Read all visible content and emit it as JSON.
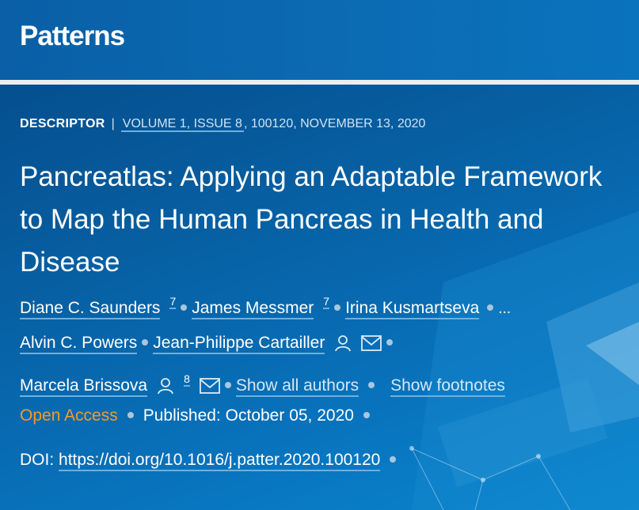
{
  "header": {
    "logo": "Patterns"
  },
  "meta": {
    "article_type": "DESCRIPTOR",
    "separator": "|",
    "issue_link": "VOLUME 1, ISSUE 8",
    "issue_rest": ", 100120, NOVEMBER 13, 2020"
  },
  "article": {
    "title": "Pancreatlas: Applying an Adaptable Framework to Map the Human Pancreas in Health and Disease",
    "authors": [
      {
        "name": "Diane C. Saunders",
        "sup": "7"
      },
      {
        "name": "James Messmer",
        "sup": "7"
      },
      {
        "name": "Irina Kusmartseva"
      },
      {
        "name": "Alvin C. Powers"
      },
      {
        "name": "Jean-Philippe Cartailler"
      },
      {
        "name": "Marcela Brissova",
        "sup": "8"
      }
    ],
    "ellipsis": "...",
    "show_all_authors": "Show all authors",
    "show_footnotes": "Show footnotes",
    "open_access": "Open Access",
    "published_label": "Published:",
    "published_date": "October 05, 2020",
    "doi_label": "DOI:",
    "doi_link": "https://doi.org/10.1016/j.patter.2020.100120"
  },
  "colors": {
    "header_bg": "#0a63a8",
    "hero_bg": "#0760a3",
    "open_access": "#f39a2a",
    "link_underline": "#6fb0dc"
  },
  "icons": [
    "person-icon",
    "mail-icon"
  ]
}
